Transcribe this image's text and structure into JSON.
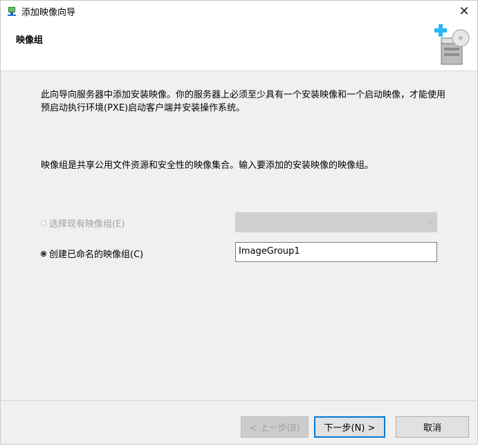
{
  "window": {
    "title": "添加映像向导",
    "close_label": "✕"
  },
  "header": {
    "title": "映像组",
    "icon": "server-add-icon"
  },
  "content": {
    "paragraph1": "此向导向服务器中添加安装映像。你的服务器上必须至少具有一个安装映像和一个启动映像，才能使用预启动执行环境(PXE)启动客户端并安装操作系统。",
    "paragraph2": "映像组是共享公用文件资源和安全性的映像集合。输入要添加的安装映像的映像组。",
    "option_existing": {
      "label": "选择现有映像组(E)",
      "selected": false,
      "enabled": false,
      "combo_value": ""
    },
    "option_create": {
      "label": "创建已命名的映像组(C)",
      "selected": true,
      "enabled": true,
      "value": "ImageGroup1"
    }
  },
  "footer": {
    "back_label": "< 上一步(B)",
    "next_label": "下一步(N) >",
    "cancel_label": "取消"
  },
  "colors": {
    "accent": "#0078d7",
    "dialog_bg": "#f0f0f0",
    "disabled_text": "#a0a0a0"
  }
}
